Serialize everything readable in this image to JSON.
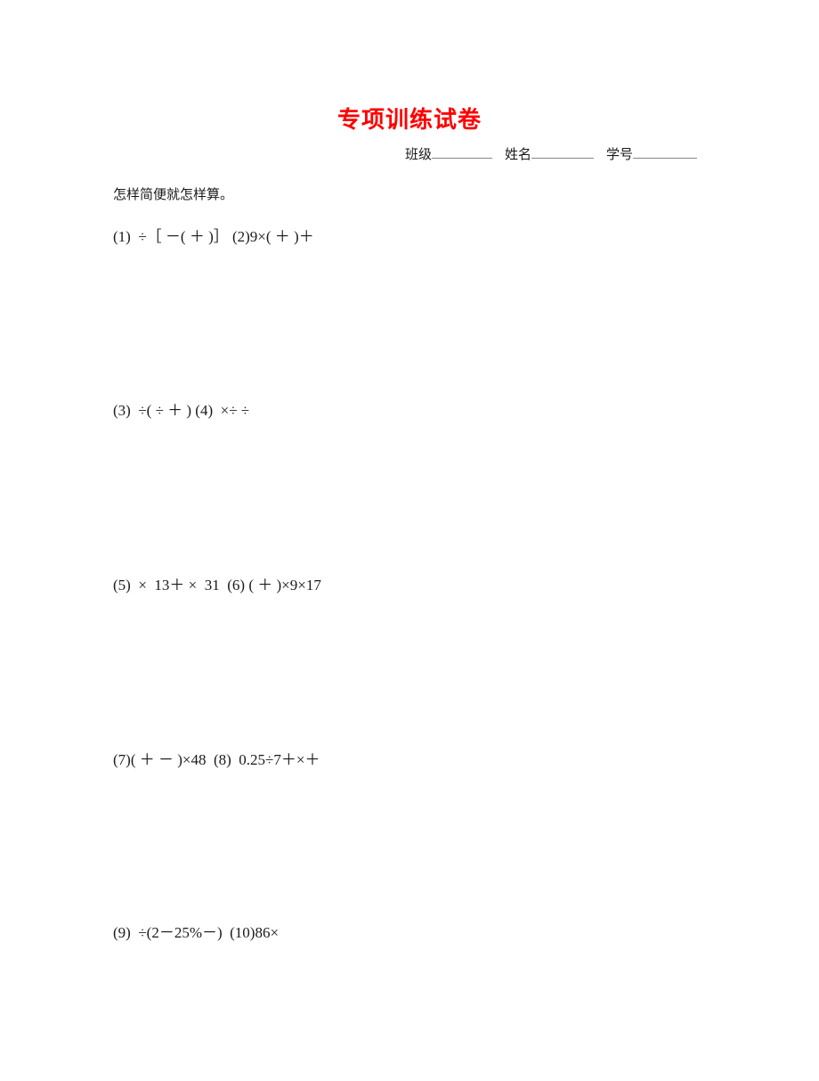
{
  "document": {
    "title": "专项训练试卷",
    "title_color": "#ff0000",
    "instruction": "怎样简便就怎样算。",
    "header_fields": [
      {
        "label": "班级",
        "blank": "________"
      },
      {
        "label": "姓名",
        "blank": "________"
      },
      {
        "label": "学号",
        "blank": "________"
      }
    ],
    "problem_rows": [
      {
        "text": "(1)  ÷［ －( ＋ )］ (2)9×( ＋ )＋"
      },
      {
        "text": "(3)  ÷( ÷ ＋ ) (4)  ×÷ ÷"
      },
      {
        "text": "(5)  ×  13＋ ×  31  (6) ( ＋ )×9×17"
      },
      {
        "text": "(7)( ＋ － )×48  (8)  0.25÷7＋×＋"
      },
      {
        "text": "(9)  ÷(2－25%－)  (10)86×"
      }
    ]
  }
}
